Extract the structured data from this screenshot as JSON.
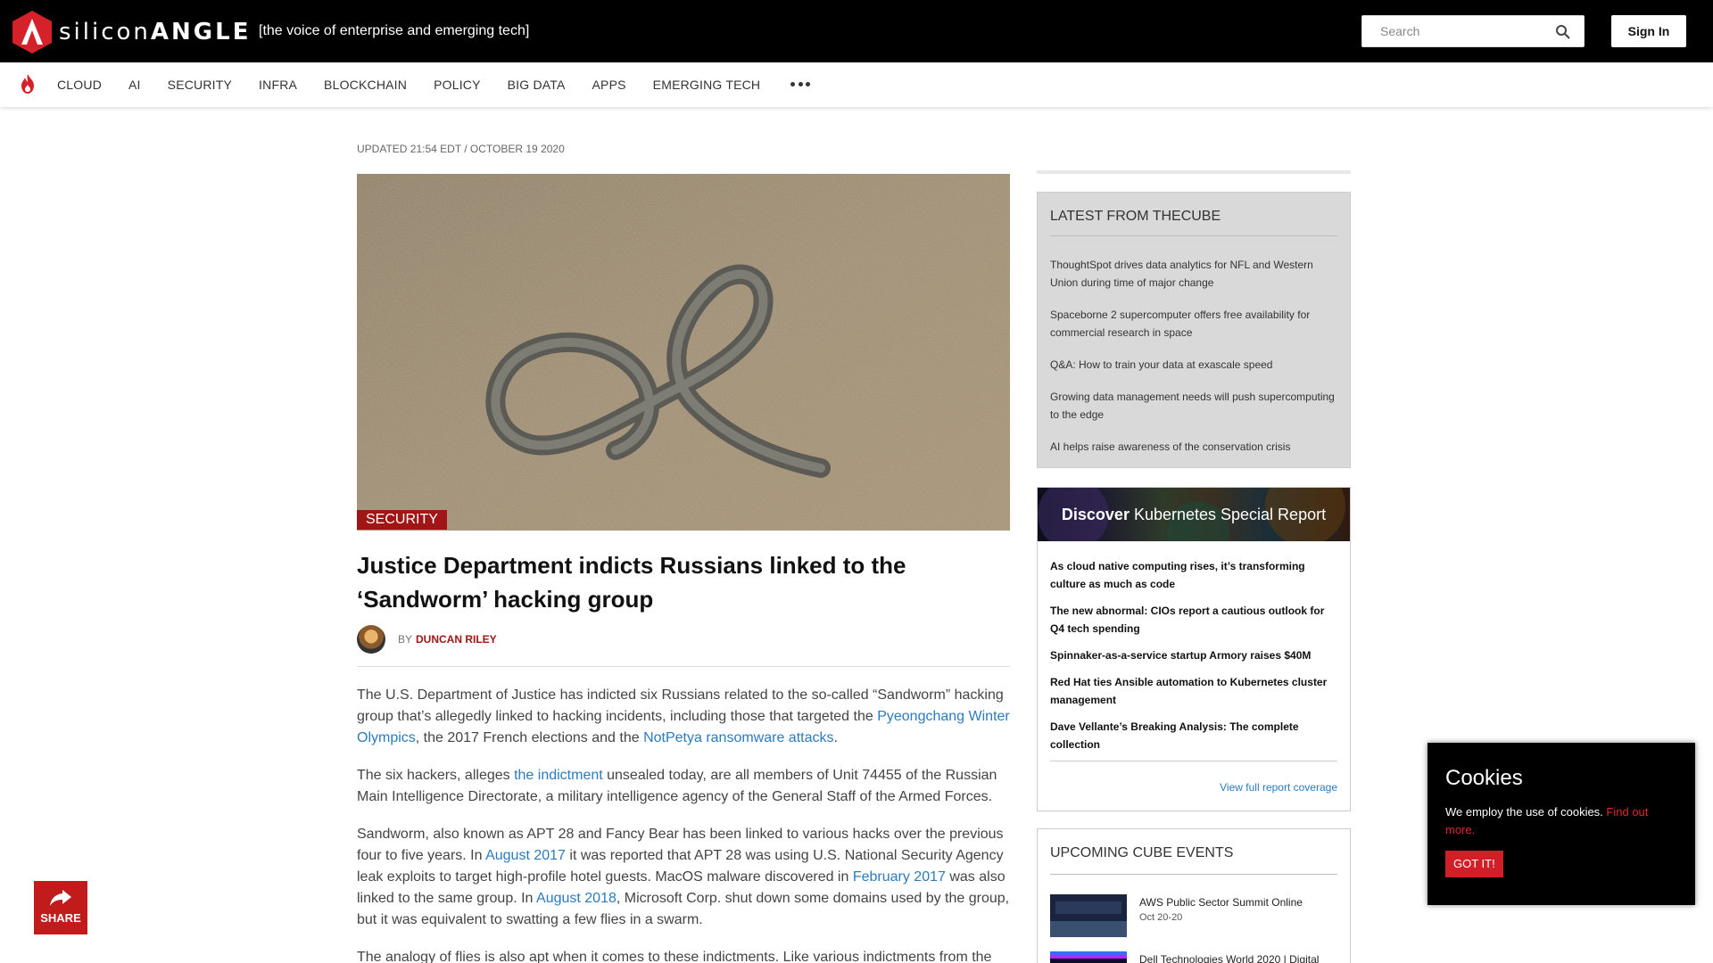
{
  "header": {
    "logo_text_bold": "silicon",
    "logo_text_rest": "ANGLE",
    "tagline": "[the voice of enterprise and emerging tech]",
    "search_placeholder": "Search",
    "signin_label": "Sign In"
  },
  "nav": {
    "items": [
      "CLOUD",
      "AI",
      "SECURITY",
      "INFRA",
      "BLOCKCHAIN",
      "POLICY",
      "BIG DATA",
      "APPS",
      "EMERGING TECH"
    ],
    "more_icon": "more-dots-icon",
    "fire_icon": "fire-icon"
  },
  "article": {
    "updated": "UPDATED 21:54 EDT / OCTOBER 19 2020",
    "category": "SECURITY",
    "title": "Justice Department indicts Russians linked to the ‘Sandworm’ hacking group",
    "by": "BY",
    "author": "DUNCAN RILEY",
    "p1_a": "The U.S. Department of Justice has indicted six Russians related to the so-called “Sandworm” hacking group that’s allegedly linked to hacking incidents, including those that targeted the ",
    "p1_link1": "Pyeongchang Winter Olympics",
    "p1_b": ", the 2017 French elections and the ",
    "p1_link2": "NotPetya ransomware attacks",
    "p1_c": ".",
    "p2_a": "The six hackers, alleges ",
    "p2_link": "the indictment",
    "p2_b": " unsealed today, are all members of Unit 74455 of the Russian Main Intelligence Directorate, a military intelligence agency of the General Staff of the Armed Forces.",
    "p3_a": "Sandworm, also known as APT 28 and Fancy Bear has been linked to various hacks over the previous four to five years. In ",
    "p3_link1": "August 2017",
    "p3_b": " it was reported that APT 28 was using U.S. National Security Agency leak exploits to target high-profile hotel guests. MacOS malware discovered in ",
    "p3_link2": "February 2017",
    "p3_c": " was also linked to the same group. In ",
    "p3_link3": "August 2018",
    "p3_d": ", Microsoft Corp. shut down some domains used by the group, but it was equivalent to swatting a few flies in a swarm.",
    "p4": "The analogy of flies is also apt when it comes to these indictments. Like various indictments from the"
  },
  "sidebar": {
    "cube_heading": "LATEST FROM THECUBE",
    "cube_items": [
      "ThoughtSpot drives data analytics for NFL and Western Union during time of major change",
      "Spaceborne 2 supercomputer offers free availability for commercial research in space",
      "Q&A: How to train your data at exascale speed",
      "Growing data management needs will push supercomputing to the edge",
      "AI helps raise awareness of the conservation crisis"
    ],
    "kube_banner_bold": "Discover",
    "kube_banner_rest": " Kubernetes Special Report",
    "kube_items": [
      "As cloud native computing rises, it’s transforming culture as much as code",
      "The new abnormal: CIOs report a cautious outlook for Q4 tech spending",
      "Spinnaker-as-a-service startup Armory raises $40M",
      "Red Hat ties Ansible automation to Kubernetes cluster management",
      "Dave Vellante’s Breaking Analysis: The complete collection"
    ],
    "kube_link": "View full report coverage",
    "events_heading": "UPCOMING CUBE EVENTS",
    "events": [
      {
        "title": "AWS Public Sector Summit Online",
        "date": "Oct 20-20"
      },
      {
        "title": "Dell Technologies World 2020 | Digital",
        "date": ""
      }
    ]
  },
  "cookie": {
    "title": "Cookies",
    "text": "We employ the use of cookies. ",
    "link": "Find out more.",
    "button": "GOT IT!"
  },
  "share": {
    "label": "SHARE",
    "icon": "share-arrow-icon"
  },
  "colors": {
    "brand_red": "#a01515",
    "link_blue": "#2a7bc0",
    "header_black": "#000000"
  }
}
